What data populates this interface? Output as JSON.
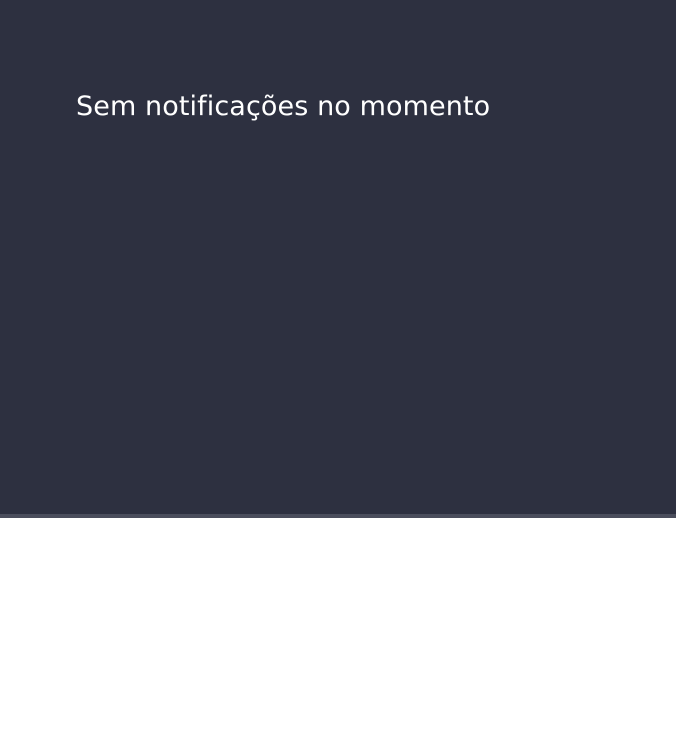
{
  "notifications_panel": {
    "empty_message": "Sem notificações no momento",
    "background_color": "#2d3040",
    "text_color": "#ffffff"
  }
}
